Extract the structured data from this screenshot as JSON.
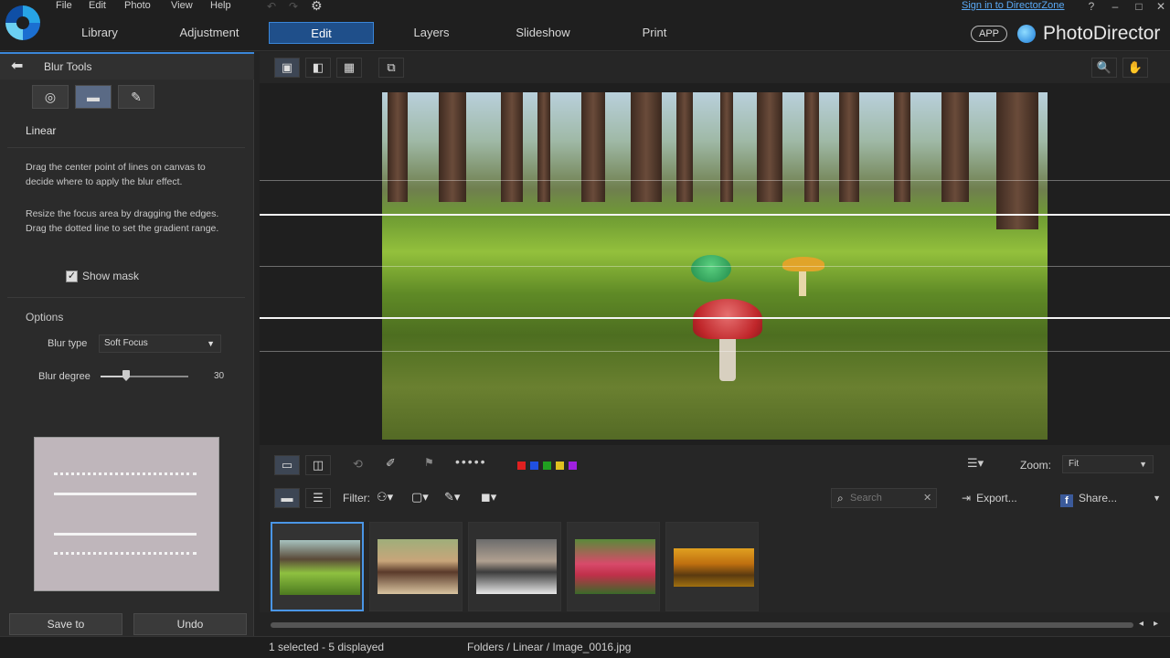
{
  "menu": [
    "File",
    "Edit",
    "Photo",
    "View",
    "Help"
  ],
  "tabs": [
    "Library",
    "Adjustment",
    "Edit",
    "Layers",
    "Slideshow",
    "Print"
  ],
  "active_tab": "Edit",
  "signin": "Sign in to DirectorZone",
  "app_badge": "APP",
  "brand": "PhotoDirector",
  "panel": {
    "title": "Blur Tools",
    "section": "Linear",
    "desc1": "Drag the center point of lines on canvas to decide where to apply the blur effect.",
    "desc2": "Resize the focus area by dragging the edges. Drag the dotted line to set the gradient range.",
    "show_mask": "Show mask",
    "options": "Options",
    "blur_type_label": "Blur type",
    "blur_type_value": "Soft Focus",
    "blur_degree_label": "Blur degree",
    "blur_degree_value": "30",
    "save_to": "Save to",
    "undo": "Undo"
  },
  "zoom": {
    "label": "Zoom:",
    "value": "Fit"
  },
  "filter_label": "Filter:",
  "search": {
    "placeholder": "Search"
  },
  "export_label": "Export...",
  "share_label": "Share...",
  "status": {
    "left": "1 selected - 5 displayed",
    "path": "Folders / Linear / Image_0016.jpg"
  },
  "colors": {
    "accent": "#3a86d8",
    "labels": [
      "#e02020",
      "#2050e0",
      "#20a020",
      "#e0c020",
      "#a020e0"
    ]
  }
}
